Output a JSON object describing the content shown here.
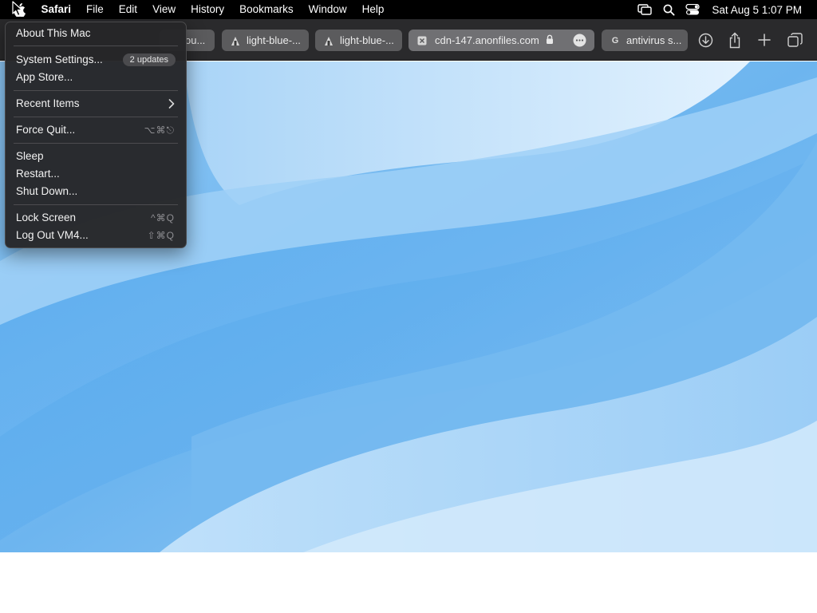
{
  "menubar": {
    "app_name": "Safari",
    "items": [
      "File",
      "Edit",
      "View",
      "History",
      "Bookmarks",
      "Window",
      "Help"
    ],
    "clock": "Sat Aug 5  1:07 PM",
    "icons": [
      "screen-mirroring-icon",
      "spotlight-search-icon",
      "control-center-icon"
    ]
  },
  "tabs": [
    {
      "label": "ou...",
      "favicon": "none"
    },
    {
      "label": "light-blue-...",
      "favicon": "macos-icon"
    },
    {
      "label": "light-blue-...",
      "favicon": "macos-icon"
    },
    {
      "label": "cdn-147.anonfiles.com",
      "favicon": "close-icon",
      "active": true
    },
    {
      "label": "antivirus s...",
      "favicon": "G"
    }
  ],
  "toolbar_buttons": [
    "download-icon",
    "share-icon",
    "new-tab-icon",
    "tab-overview-icon"
  ],
  "apple_menu": {
    "about": "About This Mac",
    "system_settings": "System Settings...",
    "updates_badge": "2 updates",
    "app_store": "App Store...",
    "recent_items": "Recent Items",
    "force_quit": "Force Quit...",
    "force_quit_shortcut": "⌥⌘⎋",
    "sleep": "Sleep",
    "restart": "Restart...",
    "shut_down": "Shut Down...",
    "lock_screen": "Lock Screen",
    "lock_screen_shortcut": "^⌘Q",
    "log_out": "Log Out VM4...",
    "log_out_shortcut": "⇧⌘Q"
  },
  "colors": {
    "menubar": "#000000",
    "toolbar": "#2a2a2c",
    "menu_bg": "#262628",
    "wallpaper_light": "#d6ecfd",
    "wallpaper_mid": "#8cc6f4",
    "wallpaper_deep": "#4aa3ec"
  }
}
